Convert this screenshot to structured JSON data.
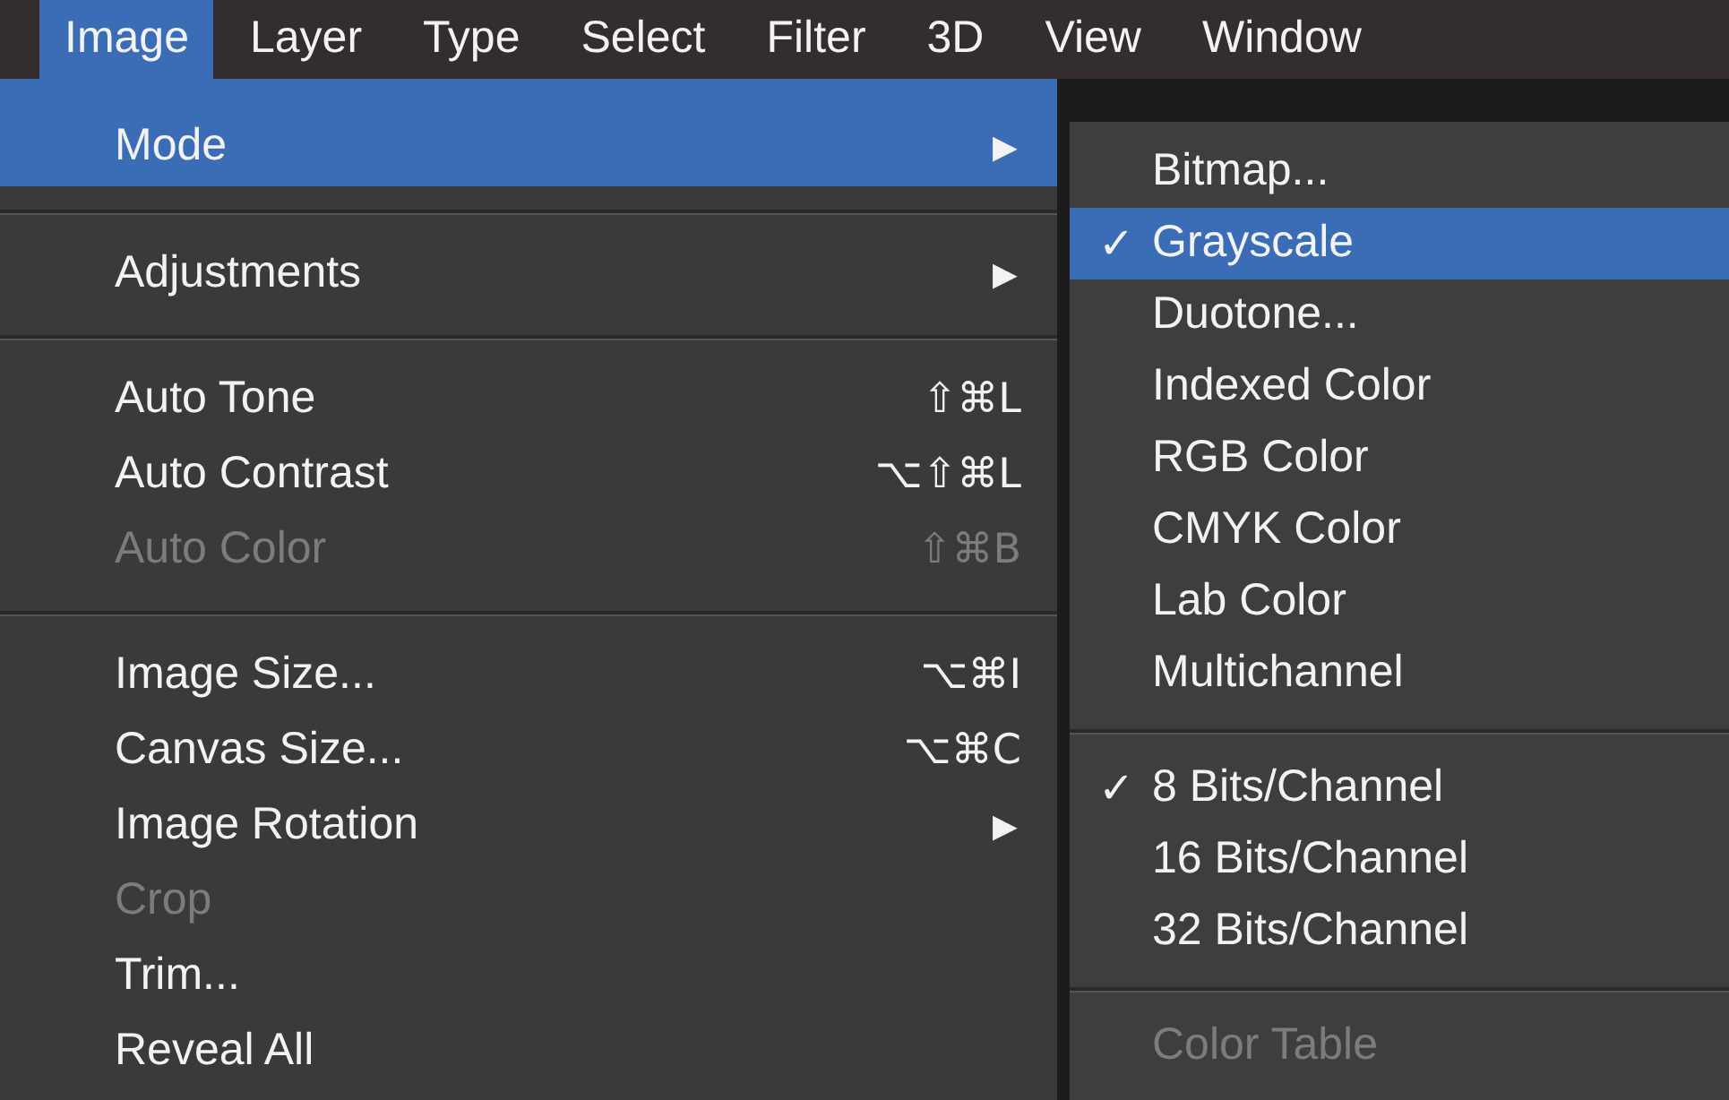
{
  "menubar": [
    {
      "label": "Image",
      "selected": true
    },
    {
      "label": "Layer",
      "selected": false
    },
    {
      "label": "Type",
      "selected": false
    },
    {
      "label": "Select",
      "selected": false
    },
    {
      "label": "Filter",
      "selected": false
    },
    {
      "label": "3D",
      "selected": false
    },
    {
      "label": "View",
      "selected": false
    },
    {
      "label": "Window",
      "selected": false
    }
  ],
  "menu": [
    {
      "kind": "item",
      "label": "Mode",
      "arrow": "▶",
      "highlighted": true,
      "disabled": false
    },
    {
      "kind": "separator"
    },
    {
      "kind": "item",
      "label": "Adjustments",
      "arrow": "▶",
      "highlighted": false,
      "disabled": false
    },
    {
      "kind": "separator"
    },
    {
      "kind": "item",
      "label": "Auto Tone",
      "shortcut": "⇧⌘L",
      "highlighted": false,
      "disabled": false
    },
    {
      "kind": "item",
      "label": "Auto Contrast",
      "shortcut": "⌥⇧⌘L",
      "highlighted": false,
      "disabled": false
    },
    {
      "kind": "item",
      "label": "Auto Color",
      "shortcut": "⇧⌘B",
      "highlighted": false,
      "disabled": true
    },
    {
      "kind": "separator"
    },
    {
      "kind": "item",
      "label": "Image Size...",
      "shortcut": "⌥⌘I",
      "highlighted": false,
      "disabled": false
    },
    {
      "kind": "item",
      "label": "Canvas Size...",
      "shortcut": "⌥⌘C",
      "highlighted": false,
      "disabled": false
    },
    {
      "kind": "item",
      "label": "Image Rotation",
      "arrow": "▶",
      "highlighted": false,
      "disabled": false
    },
    {
      "kind": "item",
      "label": "Crop",
      "highlighted": false,
      "disabled": true
    },
    {
      "kind": "item",
      "label": "Trim...",
      "highlighted": false,
      "disabled": false
    },
    {
      "kind": "item",
      "label": "Reveal All",
      "highlighted": false,
      "disabled": false
    }
  ],
  "submenu": [
    {
      "kind": "item",
      "label": "Bitmap...",
      "checked": false,
      "highlighted": false,
      "disabled": false
    },
    {
      "kind": "item",
      "label": "Grayscale",
      "checked": true,
      "highlighted": true,
      "disabled": false
    },
    {
      "kind": "item",
      "label": "Duotone...",
      "checked": false,
      "highlighted": false,
      "disabled": false
    },
    {
      "kind": "item",
      "label": "Indexed Color",
      "checked": false,
      "highlighted": false,
      "disabled": false
    },
    {
      "kind": "item",
      "label": "RGB Color",
      "checked": false,
      "highlighted": false,
      "disabled": false
    },
    {
      "kind": "item",
      "label": "CMYK Color",
      "checked": false,
      "highlighted": false,
      "disabled": false
    },
    {
      "kind": "item",
      "label": "Lab Color",
      "checked": false,
      "highlighted": false,
      "disabled": false
    },
    {
      "kind": "item",
      "label": "Multichannel",
      "checked": false,
      "highlighted": false,
      "disabled": false
    },
    {
      "kind": "separator"
    },
    {
      "kind": "item",
      "label": "8 Bits/Channel",
      "checked": true,
      "highlighted": false,
      "disabled": false
    },
    {
      "kind": "item",
      "label": "16 Bits/Channel",
      "checked": false,
      "highlighted": false,
      "disabled": false
    },
    {
      "kind": "item",
      "label": "32 Bits/Channel",
      "checked": false,
      "highlighted": false,
      "disabled": false
    },
    {
      "kind": "separator"
    },
    {
      "kind": "item",
      "label": "Color Table",
      "checked": false,
      "highlighted": false,
      "disabled": true
    }
  ],
  "check_mark": "✓"
}
